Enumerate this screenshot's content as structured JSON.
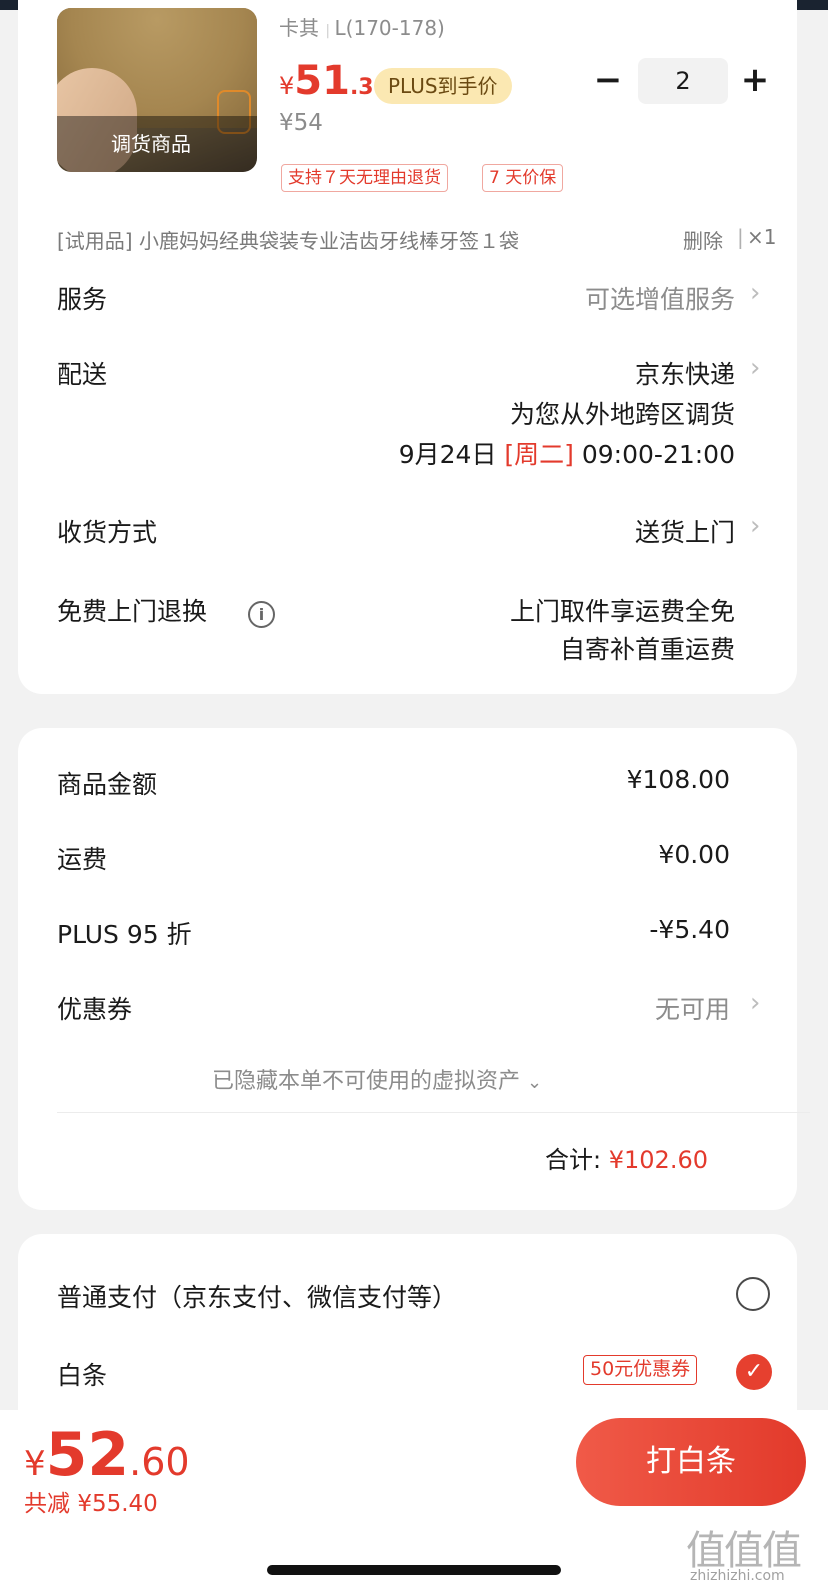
{
  "product": {
    "thumb_label": "调货商品",
    "spec_color": "卡其",
    "spec_size": "L(170-178)",
    "price_symbol": "¥",
    "price_int": "51",
    "price_dec": ".3",
    "plus_tag": "PLUS到手价",
    "original_price": "¥54",
    "quantity": "2",
    "tags": [
      "支持７天无理由退货",
      "7 天价保"
    ],
    "gift_text": "[试用品] 小鹿妈妈经典袋装专业洁齿牙线棒牙签１袋",
    "gift_delete": "删除",
    "gift_qty": "×1"
  },
  "delivery": {
    "service_label": "服务",
    "service_value": "可选增值服务",
    "shipping_label": "配送",
    "shipping_carrier": "京东快递",
    "shipping_note": "为您从外地跨区调货",
    "shipping_date": "9月24日",
    "shipping_weekday": "[周二]",
    "shipping_time": "09:00-21:00",
    "receive_label": "收货方式",
    "receive_value": "送货上门",
    "return_label": "免费上门退换",
    "return_value_1": "上门取件享运费全免",
    "return_value_2": "自寄补首重运费"
  },
  "summary": {
    "goods_label": "商品金额",
    "goods_value": "¥108.00",
    "freight_label": "运费",
    "freight_value": "¥0.00",
    "plus_label": "PLUS 95 折",
    "plus_value": "-¥5.40",
    "coupon_label": "优惠券",
    "coupon_value": "无可用",
    "hidden_assets": "已隐藏本单不可使用的虚拟资产",
    "total_label": "合计:",
    "total_value": "¥102.60"
  },
  "payment": {
    "normal_label": "普通支付（京东支付、微信支付等）",
    "baitiao_label": "白条",
    "baitiao_coupon": "50元优惠券"
  },
  "bottom": {
    "price_symbol": "¥",
    "price_int": "52",
    "price_dec": ".60",
    "saved_label": "共减",
    "saved_value": "¥55.40",
    "cta_label": "打白条"
  },
  "watermark": {
    "logo": "值值值",
    "site": "zhizhizhi.com"
  },
  "colors": {
    "accent": "#e33a2c",
    "plus_bg": "#fbe8b2"
  }
}
